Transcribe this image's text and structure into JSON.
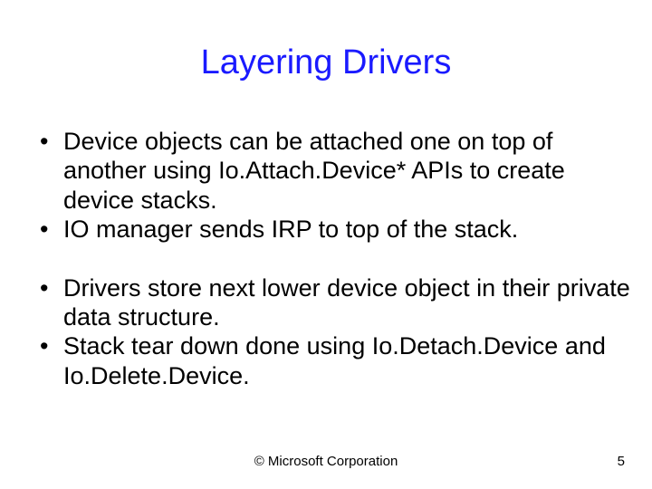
{
  "title": "Layering Drivers",
  "bullets": {
    "b1": "Device objects can be attached one on top of another using Io.Attach.Device* APIs to create device stacks.",
    "b2": "IO  manager sends IRP to top of the stack.",
    "b3": "Drivers store next lower device object in their private data structure.",
    "b4": "Stack tear down done using Io.Detach.Device and Io.Delete.Device."
  },
  "footer": {
    "copyright": "© Microsoft Corporation",
    "page": "5"
  }
}
